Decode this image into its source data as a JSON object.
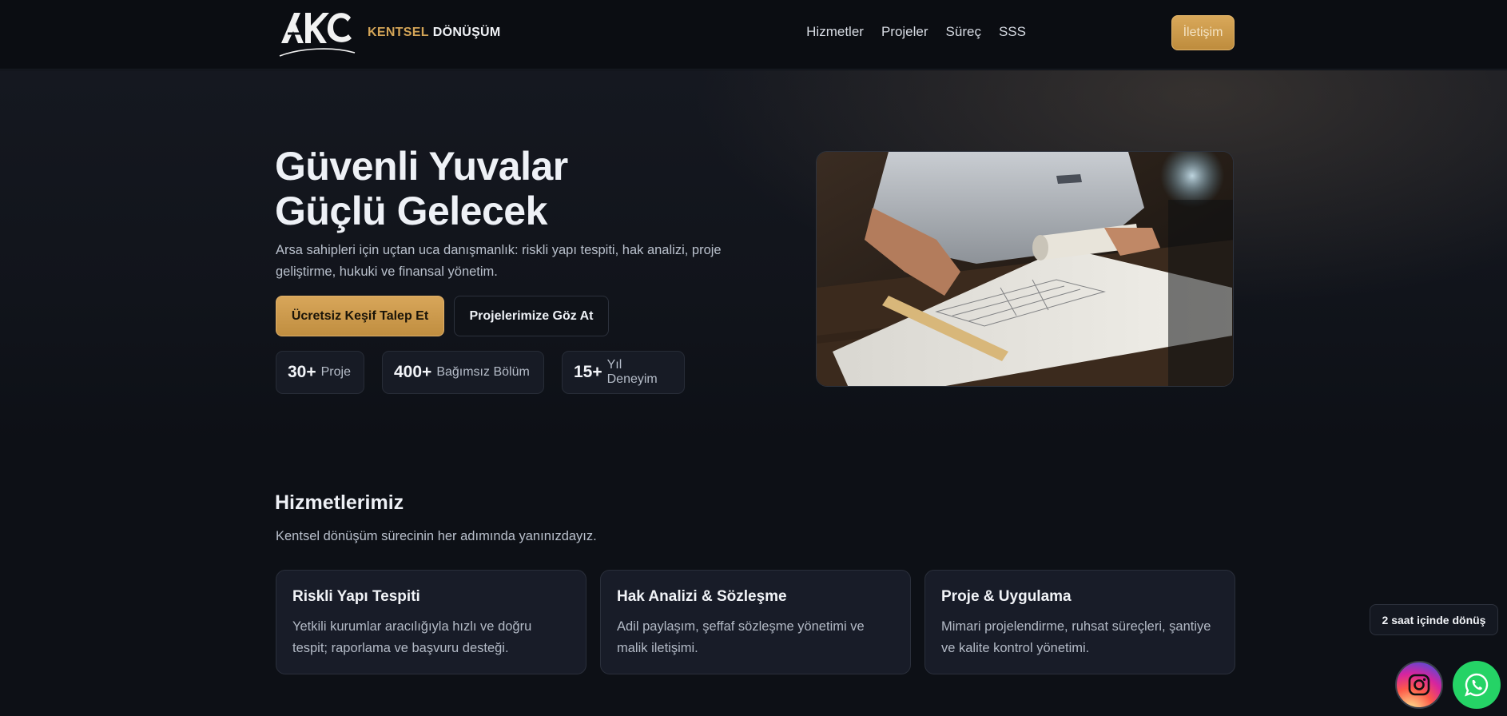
{
  "header": {
    "brand_part1": "KENTSEL",
    "brand_part2": "DÖNÜŞÜM",
    "logo_icon": "akc-logo-icon",
    "nav": [
      "Hizmetler",
      "Projeler",
      "Süreç",
      "SSS"
    ],
    "contact_label": "İletişim"
  },
  "hero": {
    "title_line1": "Güvenli Yuvalar",
    "title_line2": "Güçlü Gelecek",
    "subtitle": "Arsa sahipleri için uçtan uca danışmanlık: riskli yapı tespiti, hak analizi, proje geliştirme, hukuki ve finansal yönetim.",
    "primary_cta": "Ücretsiz Keşif Talep Et",
    "secondary_cta": "Projelerimize Göz At",
    "stats": [
      {
        "value": "30+",
        "label": "Proje"
      },
      {
        "value": "400+",
        "label": "Bağımsız Bölüm"
      },
      {
        "value": "15+",
        "label": "Yıl Deneyim"
      }
    ],
    "photo": "architect-blueprint-photo"
  },
  "services": {
    "title": "Hizmetlerimiz",
    "subtitle": "Kentsel dönüşüm sürecinin her adımında yanınızdayız.",
    "cards": [
      {
        "title": "Riskli Yapı Tespiti",
        "text": "Yetkili kurumlar aracılığıyla hızlı ve doğru tespit; raporlama ve başvuru desteği."
      },
      {
        "title": "Hak Analizi & Sözleşme",
        "text": "Adil paylaşım, şeffaf sözleşme yönetimi ve malik iletişimi."
      },
      {
        "title": "Proje & Uygulama",
        "text": "Mimari projelendirme, ruhsat süreçleri, şantiye ve kalite kontrol yönetimi."
      }
    ]
  },
  "floating": {
    "badge": "2 saat içinde dönüş",
    "instagram_icon": "instagram-icon",
    "whatsapp_icon": "whatsapp-icon"
  },
  "colors": {
    "accent": "#d3a457",
    "background": "#0d1016",
    "card": "#181c28",
    "whatsapp": "#25d366"
  }
}
